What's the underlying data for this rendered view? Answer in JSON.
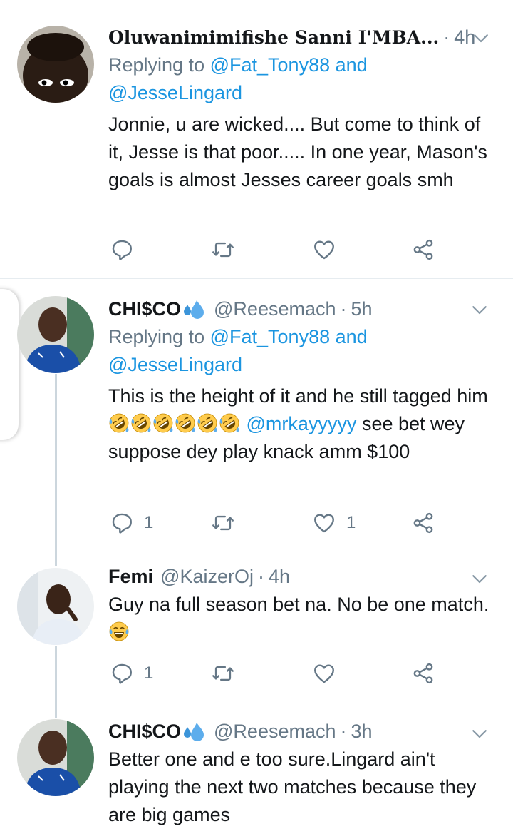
{
  "tweets": [
    {
      "name": "Oluwanimimifishe Sanni I'MBA...",
      "handle": "",
      "time": "4h",
      "replying_prefix": "Replying to",
      "replying_user1": "@Fat_Tony88",
      "replying_and": "and",
      "replying_user2": "@JesseLingard",
      "text": "Jonnie, u are wicked....  But come to think of it, Jesse is that poor..... In one year, Mason's goals is almost Jesses career goals smh",
      "reply_count": "",
      "retweet_count": "",
      "like_count": ""
    },
    {
      "name": "CHI$CO",
      "handle": "@Reesemach",
      "time": "5h",
      "replying_prefix": "Replying to",
      "replying_user1": "@Fat_Tony88",
      "replying_and": "and",
      "replying_user2": "@JesseLingard",
      "text_part1": "This is the height of it and he still tagged him",
      "mention": "@mrkayyyyy",
      "text_part2": "see bet wey suppose dey play knack amm $100",
      "reply_count": "1",
      "retweet_count": "",
      "like_count": "1"
    },
    {
      "name": "Femi",
      "handle": "@KaizerOj",
      "time": "4h",
      "text": "Guy na full season bet na. No be one match.",
      "reply_count": "1",
      "retweet_count": "",
      "like_count": ""
    },
    {
      "name": "CHI$CO",
      "handle": "@Reesemach",
      "time": "3h",
      "text": "Better one and e too sure.Lingard ain't playing the next two matches because they are big games"
    }
  ],
  "colors": {
    "link": "#1b95e0",
    "secondary": "#657786",
    "divider": "#e6ecf0",
    "thread": "#ccd6dd"
  },
  "icons": [
    "chevron-down-icon",
    "reply-icon",
    "retweet-icon",
    "like-icon",
    "share-icon",
    "sweat-droplets-icon",
    "rofl-emoji",
    "joy-emoji"
  ]
}
